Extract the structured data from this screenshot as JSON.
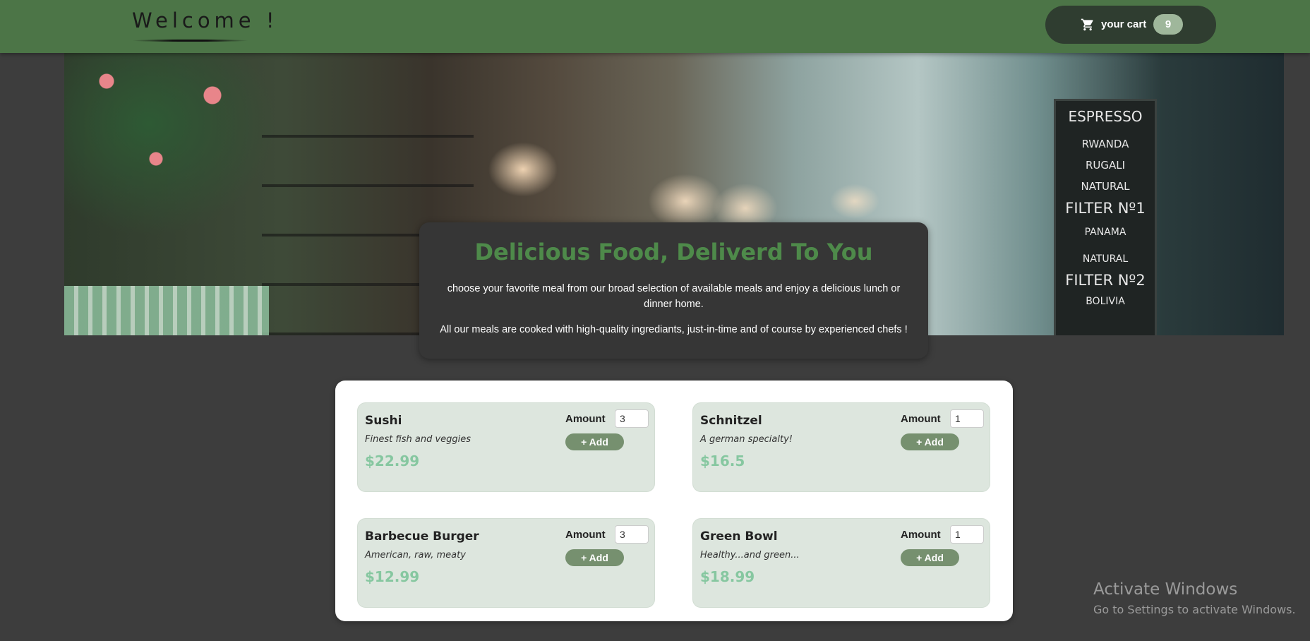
{
  "header": {
    "welcome": "Welcome !",
    "cart_label": "your cart",
    "cart_count": "9"
  },
  "hero": {
    "board_lines": [
      "ESPRESSO",
      "RWANDA",
      "RUGALI",
      "NATURAL",
      "FILTER Nº1",
      "PANAMA",
      "NATURAL",
      "FILTER Nº2",
      "BOLIVIA"
    ],
    "title": "Delicious Food, Deliverd To You",
    "text1": "choose your favorite meal from our broad selection of available meals and enjoy a delicious lunch or dinner home.",
    "text2": "All our meals are cooked with high-quality ingrediants, just-in-time and of course by experienced chefs !"
  },
  "meals": [
    {
      "name": "Sushi",
      "description": "Finest fish and veggies",
      "price": "$22.99",
      "amount_label": "Amount",
      "amount": "3",
      "add_label": "+ Add"
    },
    {
      "name": "Schnitzel",
      "description": "A german specialty!",
      "price": "$16.5",
      "amount_label": "Amount",
      "amount": "1",
      "add_label": "+ Add"
    },
    {
      "name": "Barbecue Burger",
      "description": "American, raw, meaty",
      "price": "$12.99",
      "amount_label": "Amount",
      "amount": "3",
      "add_label": "+ Add"
    },
    {
      "name": "Green Bowl",
      "description": "Healthy...and green...",
      "price": "$18.99",
      "amount_label": "Amount",
      "amount": "1",
      "add_label": "+ Add"
    }
  ],
  "watermark": {
    "title": "Activate Windows",
    "subtitle": "Go to Settings to activate Windows."
  },
  "colors": {
    "header_bg": "#4c7547",
    "page_bg": "#3d3d3d",
    "accent_title": "#4e8a4a",
    "price": "#86c7a0",
    "add_button": "#76906f"
  },
  "icons": {
    "cart": "cart-icon"
  }
}
